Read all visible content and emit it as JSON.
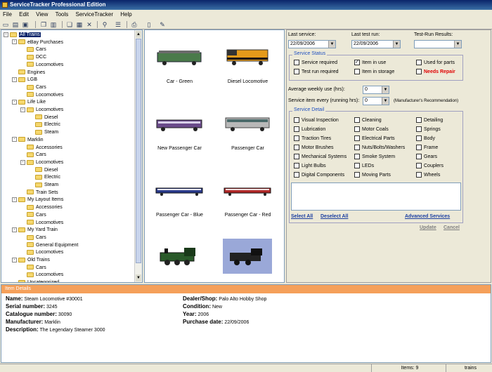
{
  "window": {
    "title": "ServiceTracker Professional Edition"
  },
  "menu": [
    "File",
    "Edit",
    "View",
    "Tools",
    "ServiceTracker",
    "Help"
  ],
  "toolbar_icons": [
    "new-icon",
    "open-icon",
    "save-icon",
    "copy-icon",
    "paste-icon",
    "cut-icon",
    "delete-icon",
    "find-icon",
    "list-icon",
    "export-icon",
    "print-icon",
    "edit-icon"
  ],
  "tree": [
    {
      "label": "All Trains",
      "level": 0,
      "expander": "-",
      "selected": true
    },
    {
      "label": "eBay Purchases",
      "level": 1,
      "expander": "-"
    },
    {
      "label": "Cars",
      "level": 2
    },
    {
      "label": "DCC",
      "level": 2
    },
    {
      "label": "Locomotives",
      "level": 2
    },
    {
      "label": "Engines",
      "level": 1
    },
    {
      "label": "LGB",
      "level": 1,
      "expander": "-"
    },
    {
      "label": "Cars",
      "level": 2
    },
    {
      "label": "Locomotives",
      "level": 2
    },
    {
      "label": "Life Like",
      "level": 1,
      "expander": "-"
    },
    {
      "label": "Locomotives",
      "level": 2,
      "expander": "-"
    },
    {
      "label": "Diesel",
      "level": 3
    },
    {
      "label": "Electric",
      "level": 3
    },
    {
      "label": "Steam",
      "level": 3
    },
    {
      "label": "Marklin",
      "level": 1,
      "expander": "-"
    },
    {
      "label": "Accessories",
      "level": 2
    },
    {
      "label": "Cars",
      "level": 2
    },
    {
      "label": "Locomotives",
      "level": 2,
      "expander": "-"
    },
    {
      "label": "Diesel",
      "level": 3
    },
    {
      "label": "Electric",
      "level": 3
    },
    {
      "label": "Steam",
      "level": 3
    },
    {
      "label": "Train Sets",
      "level": 2
    },
    {
      "label": "My Layout Items",
      "level": 1,
      "expander": "-"
    },
    {
      "label": "Accessories",
      "level": 2
    },
    {
      "label": "Cars",
      "level": 2
    },
    {
      "label": "Locomotives",
      "level": 2
    },
    {
      "label": "My Yard Train",
      "level": 1,
      "expander": "-"
    },
    {
      "label": "Cars",
      "level": 2
    },
    {
      "label": "General Equipment",
      "level": 2
    },
    {
      "label": "Locomotives",
      "level": 2
    },
    {
      "label": "Old Trains",
      "level": 1,
      "expander": "-"
    },
    {
      "label": "Cars",
      "level": 2
    },
    {
      "label": "Locomotives",
      "level": 2
    },
    {
      "label": "Uncategorized",
      "level": 1
    }
  ],
  "gallery": [
    {
      "caption": "Car - Green",
      "kind": "green-car"
    },
    {
      "caption": "Diesel Locomotive",
      "kind": "diesel"
    },
    {
      "caption": "New Passenger Car",
      "kind": "purple-car"
    },
    {
      "caption": "Passenger Car",
      "kind": "silver-car"
    },
    {
      "caption": "Passenger Car - Blue",
      "kind": "blue-car"
    },
    {
      "caption": "Passenger Car - Red",
      "kind": "red-car"
    },
    {
      "caption": "",
      "kind": "steam-green"
    },
    {
      "caption": "",
      "kind": "steam-selected"
    }
  ],
  "service": {
    "last_service_label": "Last service:",
    "last_service_value": "22/09/2006",
    "last_test_label": "Last test run:",
    "last_test_value": "22/09/2006",
    "test_results_label": "Test-Run Results:",
    "test_results_value": "",
    "status_group": "Service Status",
    "status": [
      {
        "label": "Service required",
        "checked": false
      },
      {
        "label": "Item in use",
        "checked": true
      },
      {
        "label": "Used for parts",
        "checked": false
      },
      {
        "label": "Test run required",
        "checked": false
      },
      {
        "label": "Item in storage",
        "checked": false
      },
      {
        "label": "Needs Repair",
        "checked": false,
        "color": "#e00000"
      }
    ],
    "avg_use_label": "Average weekly use (hrs):",
    "avg_use_value": "0",
    "every_label": "Service item every (running hrs):",
    "every_value": "0",
    "every_note": "(Manufacturer's Recommendation)",
    "detail_group": "Service Detail",
    "details": [
      "Visual Inspection",
      "Cleaning",
      "Detailing",
      "Lubrication",
      "Motor Coals",
      "Springs",
      "Traction Tires",
      "Electrical Parts",
      "Body",
      "Motor Brushes",
      "Nuts/Bolts/Washers",
      "Frame",
      "Mechanical Systems",
      "Smoke System",
      "Gears",
      "Light Bulbs",
      "LEDs",
      "Couplers",
      "Digital Components",
      "Moving Parts",
      "Wheels"
    ],
    "select_all": "Select All",
    "deselect_all": "Deselect All",
    "advanced": "Advanced Services",
    "update": "Update",
    "cancel": "Cancel"
  },
  "details_panel": {
    "header": "Item Details",
    "name_label": "Name:",
    "name_value": "Steam Locomotive #30001",
    "serial_label": "Serial number:",
    "serial_value": "3245",
    "catalogue_label": "Catalogue number:",
    "catalogue_value": "30090",
    "manufacturer_label": "Manufacturer:",
    "manufacturer_value": "Marklin",
    "description_label": "Description:",
    "description_value": "The Legendary Steamer 3000",
    "dealer_label": "Dealer/Shop:",
    "dealer_value": "Palo Alto Hobby Shop",
    "condition_label": "Condition:",
    "condition_value": "New",
    "year_label": "Year:",
    "year_value": "2006",
    "purchase_label": "Purchase date:",
    "purchase_value": "22/09/2006"
  },
  "statusbar": {
    "items": "Items: 9",
    "section": "trains"
  }
}
